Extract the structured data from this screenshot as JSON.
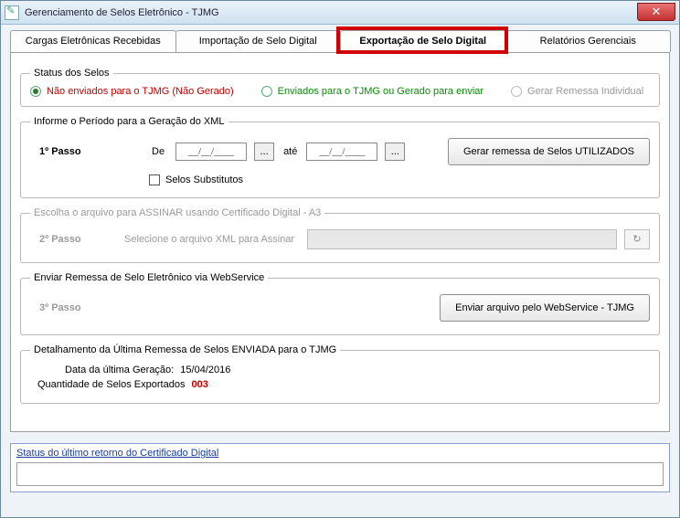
{
  "window": {
    "title": "Gerenciamento de Selos Eletrônico - TJMG"
  },
  "tabs": [
    {
      "label": "Cargas Eletrônicas Recebidas"
    },
    {
      "label": "Importação de Selo Digital"
    },
    {
      "label": "Exportação de Selo Digital"
    },
    {
      "label": "Relatórios Gerenciais"
    }
  ],
  "status_selos": {
    "legend": "Status dos Selos",
    "options": {
      "nao_enviados": "Não enviados para o TJMG (Não Gerado)",
      "enviados": "Enviados para o TJMG  ou Gerado para enviar",
      "remessa_individual": "Gerar Remessa Individual"
    }
  },
  "periodo": {
    "legend": "Informe o Período para a Geração do XML",
    "step_label": "1º Passo",
    "de_label": "De",
    "ate_label": "até",
    "date_placeholder": "__/__/____",
    "date_btn": "...",
    "gerar_btn": "Gerar remessa de Selos UTILIZADOS",
    "chk_substitutos": "Selos Substitutos"
  },
  "assinar": {
    "legend": "Escolha o arquivo para ASSINAR usando Certificado Digital - A3",
    "step_label": "2º Passo",
    "prompt": "Selecione o arquivo XML para Assinar"
  },
  "enviar": {
    "legend": "Enviar Remessa de Selo Eletrônico via WebService",
    "step_label": "3º Passo",
    "btn": "Enviar arquivo pelo WebService - TJMG"
  },
  "detalhamento": {
    "legend": "Detalhamento da Última  Remessa de Selos  ENVIADA para o  TJMG",
    "data_label": "Data da última  Geração:",
    "data_value": "15/04/2016",
    "qtd_label": "Quantidade de Selos Exportados",
    "qtd_value": "003"
  },
  "status_retorno": {
    "title": "Status do último retorno do Certificado Digital",
    "value": ""
  }
}
